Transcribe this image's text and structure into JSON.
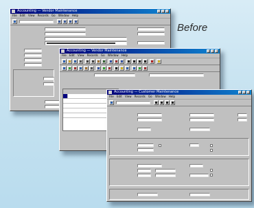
{
  "caption": "Before",
  "credit": "",
  "colors": {
    "background": "#c6e2f0",
    "titlebar": "#000078",
    "window": "#c0c0c0"
  },
  "windows": [
    {
      "id": "back",
      "title": "Accounting — Vendor Maintenance",
      "menu": [
        "File",
        "Edit",
        "View",
        "Records",
        "Go",
        "Window",
        "Help"
      ]
    },
    {
      "id": "middle",
      "title": "Accounting — Vendor Maintenance",
      "menu": [
        "File",
        "Edit",
        "View",
        "Records",
        "Go",
        "Window",
        "Help"
      ]
    },
    {
      "id": "front",
      "title": "Accounting — Customer Maintenance",
      "menu": [
        "File",
        "Edit",
        "View",
        "Records",
        "Go",
        "Window",
        "Help"
      ]
    }
  ]
}
